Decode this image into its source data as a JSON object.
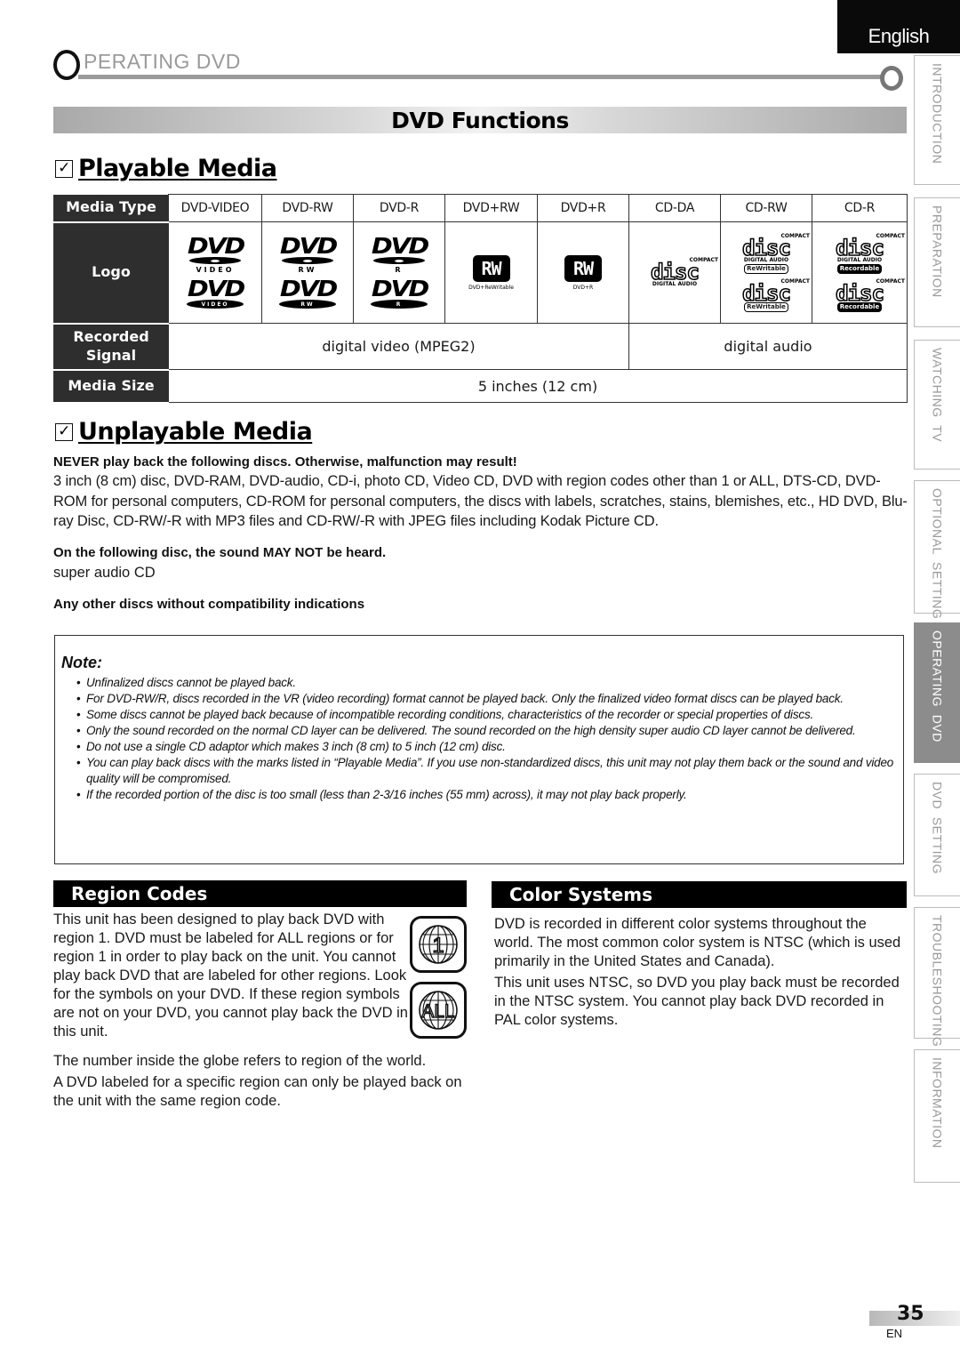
{
  "language_tab": "English",
  "chapter": {
    "initial": "O",
    "rest": "PERATING  DVD"
  },
  "section_banner": "DVD Functions",
  "playable": {
    "heading": "Playable Media",
    "row_headers": {
      "media_type": "Media Type",
      "logo": "Logo",
      "recorded_signal": "Recorded Signal",
      "media_size": "Media Size"
    },
    "columns": [
      {
        "type": "DVD-VIDEO",
        "logo_icons": [
          "dvd-video-logo",
          "dvd-video-logo-alt"
        ],
        "logo_sub": "VIDEO"
      },
      {
        "type": "DVD-RW",
        "logo_icons": [
          "dvd-rw-logo",
          "dvd-rw-logo-alt"
        ],
        "logo_sub": "RW"
      },
      {
        "type": "DVD-R",
        "logo_icons": [
          "dvd-r-logo",
          "dvd-r-logo-alt"
        ],
        "logo_sub": "R"
      },
      {
        "type": "DVD+RW",
        "logo_icons": [
          "dvd-plus-rw-logo"
        ],
        "logo_mark": "RW",
        "logo_caption": "DVD+ReWritable"
      },
      {
        "type": "DVD+R",
        "logo_icons": [
          "dvd-plus-r-logo"
        ],
        "logo_mark": "RW",
        "logo_caption": "DVD+R"
      },
      {
        "type": "CD-DA",
        "logo_icons": [
          "compact-disc-digital-audio-logo"
        ],
        "cd_top": "COMPACT",
        "cd_word": "disc",
        "cd_sub": "DIGITAL AUDIO"
      },
      {
        "type": "CD-RW",
        "logo_icons": [
          "compact-disc-rewritable-logo",
          "compact-disc-rewritable-logo-alt"
        ],
        "cd_top": "COMPACT",
        "cd_word": "disc",
        "cd_sub": "DIGITAL AUDIO",
        "cd_tag": "ReWritable"
      },
      {
        "type": "CD-R",
        "logo_icons": [
          "compact-disc-recordable-logo",
          "compact-disc-recordable-logo-alt"
        ],
        "cd_top": "COMPACT",
        "cd_word": "disc",
        "cd_sub": "DIGITAL AUDIO",
        "cd_tag": "Recordable"
      }
    ],
    "recorded_signal": {
      "dvd": "digital video (MPEG2)",
      "cd": "digital audio"
    },
    "media_size": "5 inches (12 cm)"
  },
  "unplayable": {
    "heading": "Unplayable Media",
    "never_warning": "NEVER play back the following discs. Otherwise, malfunction may result!",
    "never_list": "3 inch (8 cm) disc, DVD-RAM, DVD-audio, CD-i, photo CD, Video CD, DVD with region codes other than 1 or ALL, DTS-CD, DVD-ROM for personal computers, CD-ROM for personal computers, the discs with labels, scratches, stains, blemishes, etc., HD DVD, Blu-ray Disc, CD-RW/-R with MP3 files and CD-RW/-R with JPEG files including Kodak Picture CD.",
    "sound_warning": "On the following disc, the sound MAY NOT be heard.",
    "sound_disc": "super audio CD",
    "other_warning": "Any other discs without compatibility indications"
  },
  "note": {
    "label": "Note:",
    "items": [
      "Unfinalized discs cannot be played back.",
      "For DVD-RW/R, discs recorded in the VR (video recording) format cannot be played back. Only the finalized video format discs can be played back.",
      "Some discs cannot be played back because of incompatible recording conditions, characteristics of the recorder or special properties of discs.",
      "Only the sound recorded on the normal CD layer can be delivered. The sound recorded on the high density super audio CD layer cannot be delivered.",
      "Do not use a single CD adaptor which makes 3 inch (8 cm) to 5 inch (12 cm) disc.",
      "You can play back discs with the marks listed in “Playable Media”. If you use non-standardized discs, this unit may not play them back or the sound and video quality will be compromised.",
      "If the recorded portion of the disc is too small (less than 2-3/16 inches (55 mm) across), it may not play back properly."
    ]
  },
  "region_codes": {
    "heading": "Region Codes",
    "text": "This unit has been designed to play back DVD with region 1. DVD must be labeled for ALL regions or for region 1 in order to play back on the unit. You cannot play back DVD that are labeled for other regions. Look for the symbols on your DVD. If these region symbols are not on your DVD, you cannot play back the DVD in this unit.",
    "note1": "The number inside the globe refers to region of the world.",
    "note2": "A DVD labeled for a specific region can only be played back on the unit with the same region code.",
    "symbols": [
      "1",
      "ALL"
    ]
  },
  "color_systems": {
    "heading": "Color Systems",
    "text1": "DVD is recorded in different color systems throughout the world. The most common color system is NTSC (which is used primarily in the United States and Canada).",
    "text2": "This unit uses NTSC, so DVD you play back must be recorded in the NTSC system. You cannot play back DVD recorded in PAL color systems."
  },
  "side_nav": [
    {
      "label": "INTRODUCTION",
      "active": false
    },
    {
      "label": "PREPARATION",
      "active": false
    },
    {
      "label": "WATCHING  TV",
      "active": false
    },
    {
      "label": "OPTIONAL  SETTING",
      "active": false
    },
    {
      "label": "OPERATING  DVD",
      "active": true
    },
    {
      "label": "DVD  SETTING",
      "active": false
    },
    {
      "label": "TROUBLESHOOTING",
      "active": false
    },
    {
      "label": "INFORMATION",
      "active": false
    }
  ],
  "page": {
    "number": "35",
    "lang_code": "EN"
  },
  "colors": {
    "active_tab": "#8c8c8c",
    "header_cell": "#2e2e2e",
    "banner": "#000000"
  }
}
